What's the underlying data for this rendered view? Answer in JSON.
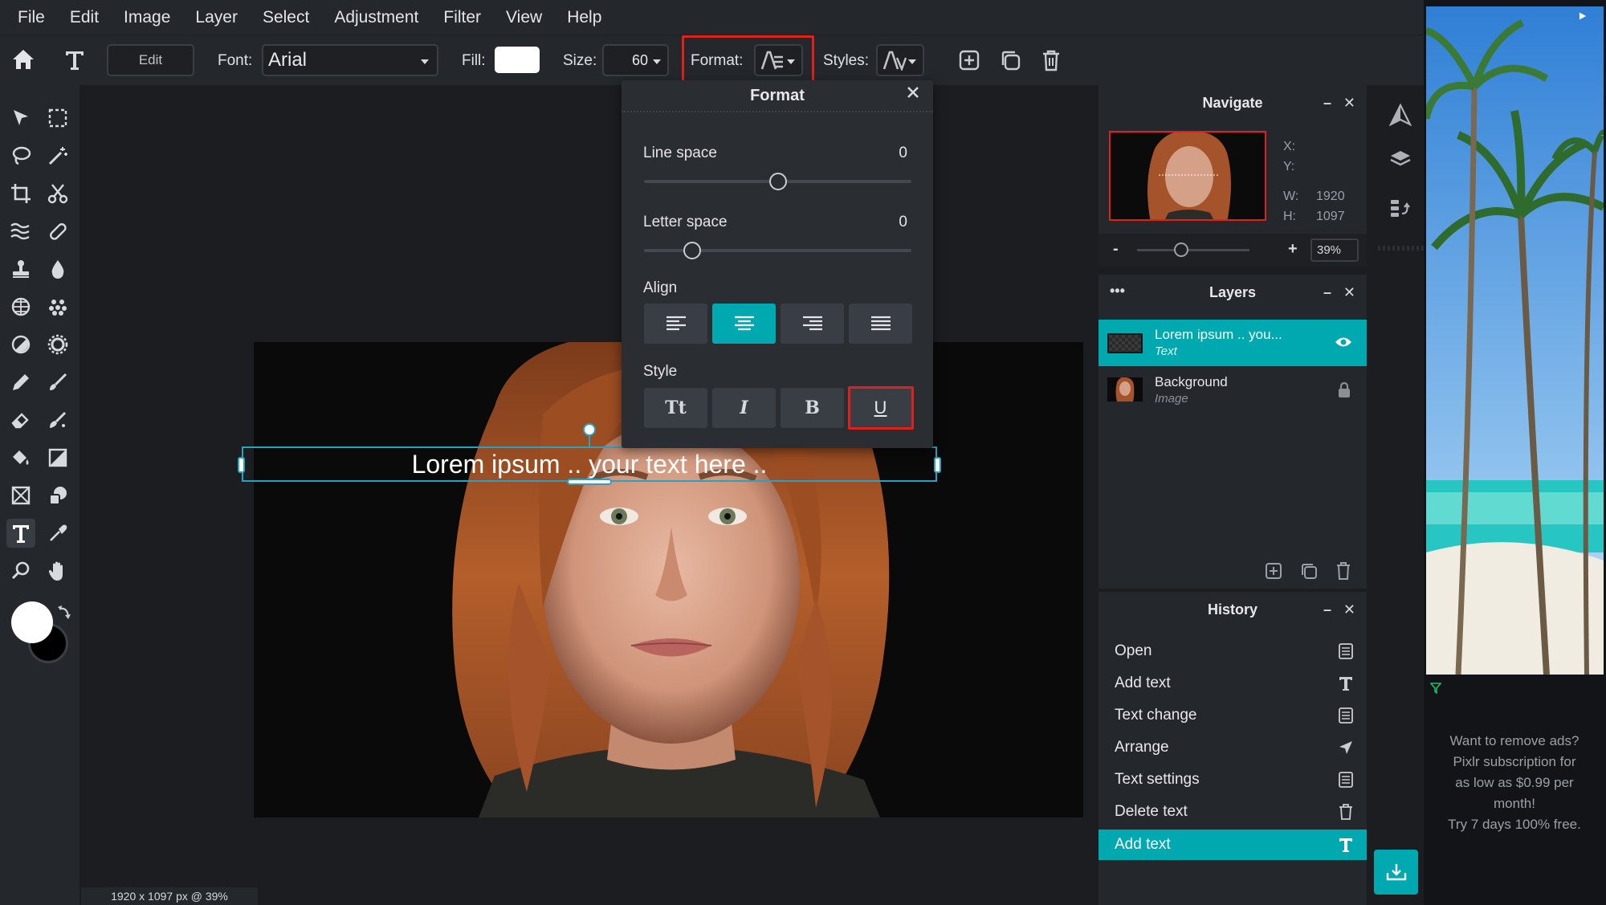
{
  "menu": [
    "File",
    "Edit",
    "Image",
    "Layer",
    "Select",
    "Adjustment",
    "Filter",
    "View",
    "Help"
  ],
  "toolbar": {
    "edit_label": "Edit",
    "font_label": "Font:",
    "font_value": "Arial",
    "fill_label": "Fill:",
    "fill_color": "#ffffff",
    "size_label": "Size:",
    "size_value": "60",
    "format_label": "Format:",
    "styles_label": "Styles:"
  },
  "canvas": {
    "text": "Lorem ipsum .. your text here ..",
    "status": "1920 x 1097 px @ 39%"
  },
  "format_panel": {
    "title": "Format",
    "line_space_label": "Line space",
    "line_space_value": "0",
    "line_space_fraction": 0.5,
    "letter_space_label": "Letter space",
    "letter_space_value": "0",
    "letter_space_fraction": 0.18,
    "align_label": "Align",
    "align_selected": "center",
    "style_label": "Style",
    "style_buttons": [
      "Tt",
      "I",
      "B",
      "U"
    ]
  },
  "navigate": {
    "title": "Navigate",
    "x_label": "X:",
    "y_label": "Y:",
    "w_label": "W:",
    "w_value": "1920",
    "h_label": "H:",
    "h_value": "1097",
    "zoom_minus": "-",
    "zoom_plus": "+",
    "zoom_value": "39%"
  },
  "layers": {
    "title": "Layers",
    "dots": "•••",
    "items": [
      {
        "name": "Lorem ipsum .. you...",
        "type": "Text"
      },
      {
        "name": "Background",
        "type": "Image"
      }
    ]
  },
  "history": {
    "title": "History",
    "items": [
      "Open",
      "Add text",
      "Text change",
      "Arrange",
      "Text settings",
      "Delete text",
      "Add text"
    ]
  },
  "ad": {
    "text_lines": [
      "Want to remove ads?",
      "Pixlr subscription for",
      "as low as $0.99 per",
      "month!",
      "Try 7 days 100% free."
    ]
  },
  "colors": {
    "accent": "#00a8b0",
    "highlight_red": "#e0201b",
    "selection_blue": "#26a3c2"
  }
}
